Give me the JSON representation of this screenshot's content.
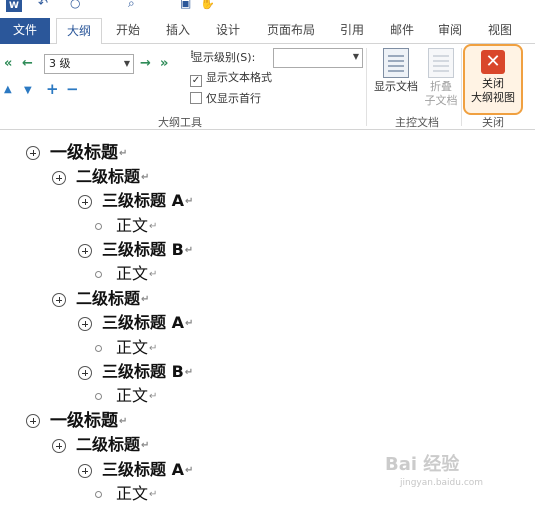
{
  "tabs": [
    {
      "label": "文件"
    },
    {
      "label": "大纲"
    },
    {
      "label": "开始"
    },
    {
      "label": "插入"
    },
    {
      "label": "设计"
    },
    {
      "label": "页面布局"
    },
    {
      "label": "引用"
    },
    {
      "label": "邮件"
    },
    {
      "label": "审阅"
    },
    {
      "label": "视图"
    }
  ],
  "ribbon": {
    "outline_tools": {
      "level_value": "3 级",
      "show_level_label": "显示级别(S):",
      "show_level_value": "",
      "show_text_format_label": "显示文本格式",
      "show_text_format_checked": true,
      "show_first_line_label": "仅显示首行",
      "show_first_line_checked": false,
      "group_label": "大纲工具"
    },
    "master_doc": {
      "show_doc_label": "显示文档",
      "collapse_line1": "折叠",
      "collapse_line2": "子文档",
      "group_label": "主控文档"
    },
    "close": {
      "line1": "关闭",
      "line2": "大纲视图",
      "group_label": "关闭"
    }
  },
  "outline": [
    {
      "level": 1,
      "text": "一级标题"
    },
    {
      "level": 2,
      "text": "二级标题"
    },
    {
      "level": 3,
      "text": "三级标题 A"
    },
    {
      "level": 4,
      "text": "正文"
    },
    {
      "level": 3,
      "text": "三级标题 B"
    },
    {
      "level": 4,
      "text": "正文"
    },
    {
      "level": 2,
      "text": "二级标题"
    },
    {
      "level": 3,
      "text": "三级标题 A"
    },
    {
      "level": 4,
      "text": "正文"
    },
    {
      "level": 3,
      "text": "三级标题 B"
    },
    {
      "level": 4,
      "text": "正文"
    },
    {
      "level": 1,
      "text": "一级标题"
    },
    {
      "level": 2,
      "text": "二级标题"
    },
    {
      "level": 3,
      "text": "三级标题 A"
    },
    {
      "level": 4,
      "text": "正文"
    }
  ],
  "paragraph_mark": "↵",
  "watermark": {
    "main": "Bai 经验",
    "sub": "jingyan.baidu.com"
  },
  "colors": {
    "accent": "#2b579a",
    "close_red": "#d9472b",
    "highlight_border": "#f0a040"
  }
}
